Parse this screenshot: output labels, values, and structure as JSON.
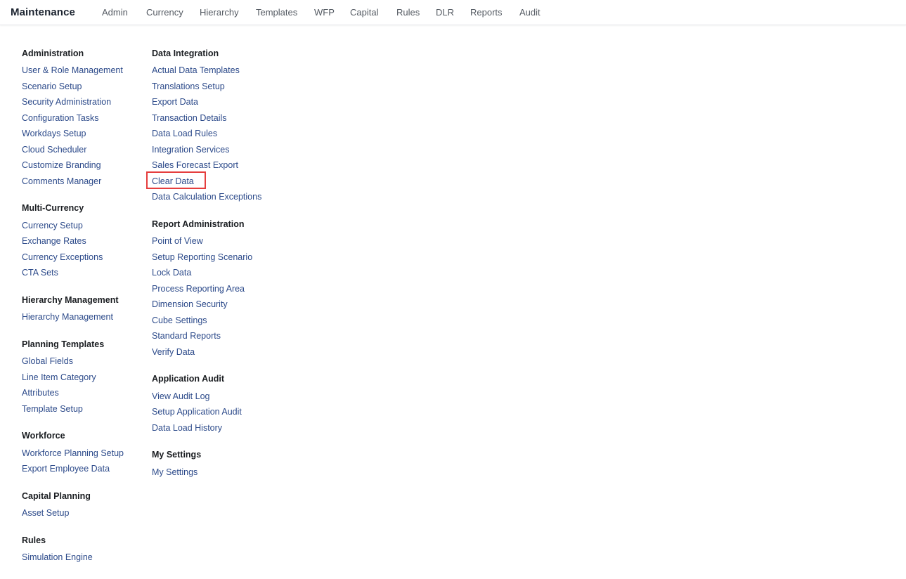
{
  "header": {
    "brand": "Maintenance",
    "nav": [
      "Admin",
      "Currency",
      "Hierarchy",
      "Templates",
      "WFP",
      "Capital",
      "Rules",
      "DLR",
      "Reports",
      "Audit"
    ]
  },
  "columns": [
    {
      "sections": [
        {
          "title": "Administration",
          "links": [
            "User & Role Management",
            "Scenario Setup",
            "Security Administration",
            "Configuration Tasks",
            "Workdays Setup",
            "Cloud Scheduler",
            "Customize Branding",
            "Comments Manager"
          ]
        },
        {
          "title": "Multi-Currency",
          "links": [
            "Currency Setup",
            "Exchange Rates",
            "Currency Exceptions",
            "CTA Sets"
          ]
        },
        {
          "title": "Hierarchy Management",
          "links": [
            "Hierarchy Management"
          ]
        },
        {
          "title": "Planning Templates",
          "links": [
            "Global Fields",
            "Line Item Category",
            "Attributes",
            "Template Setup"
          ]
        },
        {
          "title": "Workforce",
          "links": [
            "Workforce Planning Setup",
            "Export Employee Data"
          ]
        },
        {
          "title": "Capital Planning",
          "links": [
            "Asset Setup"
          ]
        },
        {
          "title": "Rules",
          "links": [
            "Simulation Engine"
          ]
        }
      ]
    },
    {
      "sections": [
        {
          "title": "Data Integration",
          "links": [
            "Actual Data Templates",
            "Translations Setup",
            "Export Data",
            "Transaction Details",
            "Data Load Rules",
            "Integration Services",
            "Sales Forecast Export",
            "Clear Data",
            "Data Calculation Exceptions"
          ]
        },
        {
          "title": "Report Administration",
          "links": [
            "Point of View",
            "Setup Reporting Scenario",
            "Lock Data",
            "Process Reporting Area",
            "Dimension Security",
            "Cube Settings",
            "Standard Reports",
            "Verify Data"
          ]
        },
        {
          "title": "Application Audit",
          "links": [
            "View Audit Log",
            "Setup Application Audit",
            "Data Load History"
          ]
        },
        {
          "title": "My Settings",
          "links": [
            "My Settings"
          ]
        }
      ]
    }
  ],
  "highlighted_link": "Clear Data",
  "colors": {
    "link": "#2c4a8a",
    "heading": "#1a1d21",
    "nav": "#555b63",
    "highlight": "#e53e3e"
  }
}
